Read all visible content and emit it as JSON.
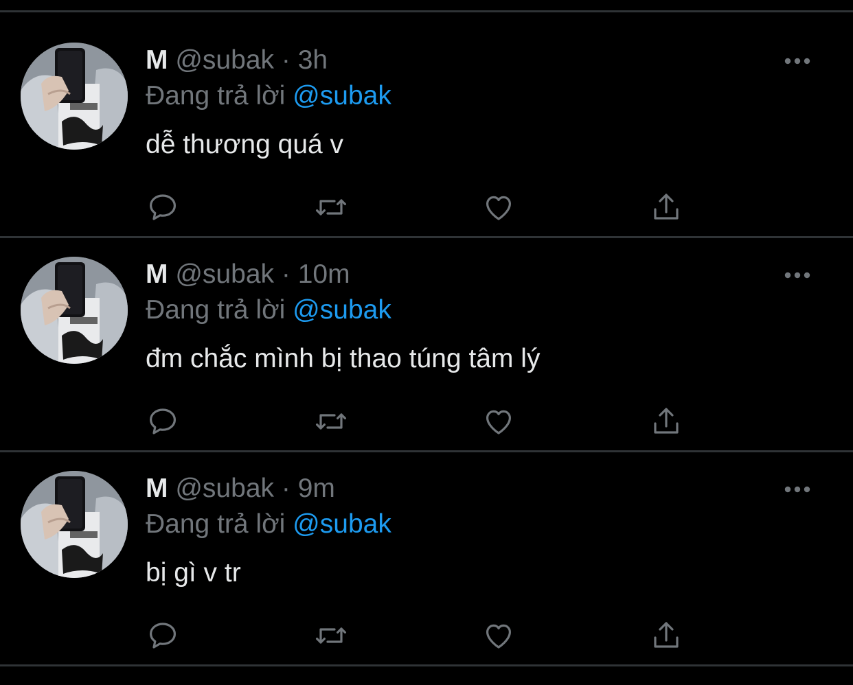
{
  "colors": {
    "background": "#000000",
    "divider": "#2f3336",
    "primary_text": "#e7e9ea",
    "secondary_text": "#71767b",
    "mention": "#1d9bf0"
  },
  "icons": {
    "more": "more-horizontal-icon",
    "reply": "reply-bubble-icon",
    "retweet": "retweet-icon",
    "like": "heart-icon",
    "share": "share-upload-icon"
  },
  "tweets": [
    {
      "name": "M",
      "handle": "@subak",
      "separator": "·",
      "time": "3h",
      "reply_prefix": "Đang trả lời",
      "reply_to": "@subak",
      "text": "dễ thương quá v"
    },
    {
      "name": "M",
      "handle": "@subak",
      "separator": "·",
      "time": "10m",
      "reply_prefix": "Đang trả lời",
      "reply_to": "@subak",
      "text": "đm chắc mình bị thao túng tâm lý"
    },
    {
      "name": "M",
      "handle": "@subak",
      "separator": "·",
      "time": "9m",
      "reply_prefix": "Đang trả lời",
      "reply_to": "@subak",
      "text": "bị gì v tr"
    }
  ]
}
